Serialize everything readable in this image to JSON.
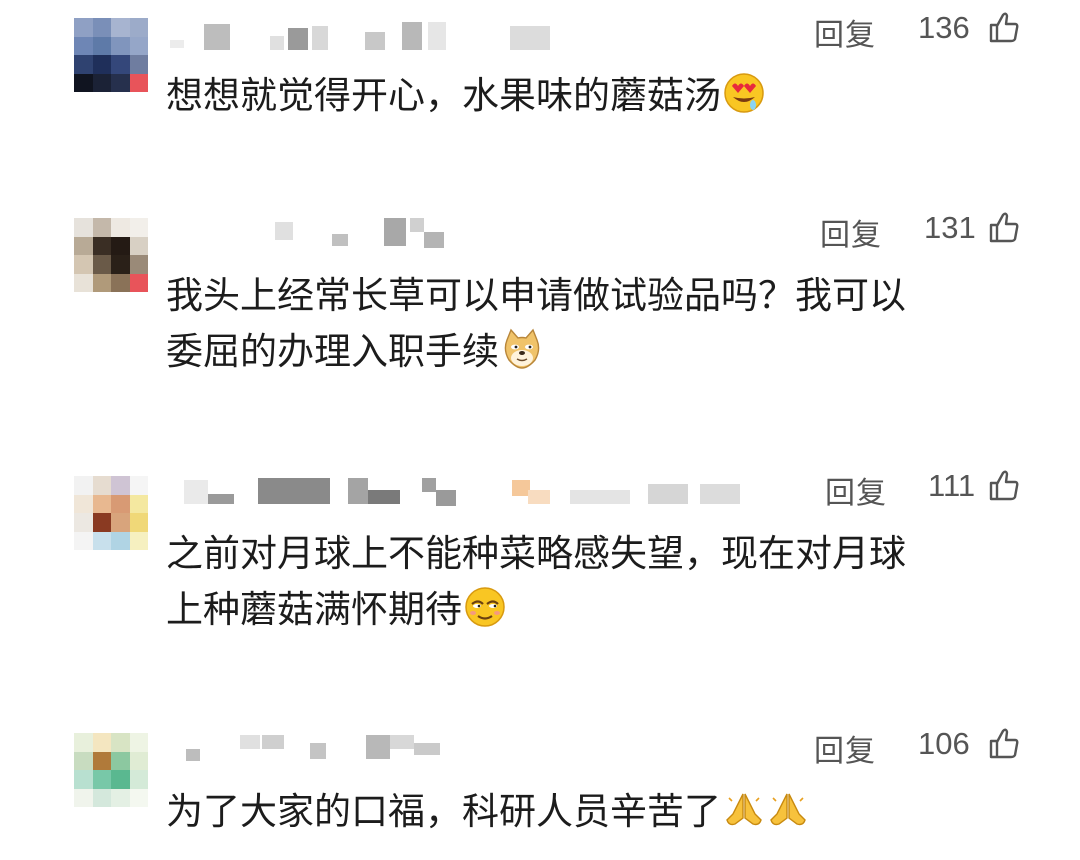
{
  "comments": [
    {
      "reply_label": "回复",
      "likes": "136",
      "text": "想想就觉得开心，水果味的蘑菇汤",
      "emoji": [
        "drooling-heart-eyes-emoji"
      ]
    },
    {
      "reply_label": "回复",
      "likes": "131",
      "text_line1": "我头上经常长草可以申请做试验品吗？我可以",
      "text_line2": "委屈的办理入职手续",
      "emoji": [
        "doge-emoji"
      ]
    },
    {
      "reply_label": "回复",
      "likes": "111",
      "text_line1": "之前对月球上不能种菜略感失望，现在对月球",
      "text_line2": "上种蘑菇满怀期待",
      "emoji": [
        "smug-face-emoji"
      ]
    },
    {
      "reply_label": "回复",
      "likes": "106",
      "text": "为了大家的口福，科研人员辛苦了",
      "emoji": [
        "praying-hands-emoji",
        "praying-hands-emoji"
      ]
    }
  ],
  "colors": {
    "text": "#1c1c1c",
    "meta": "#555555",
    "blur_gray": "#cfcfcf"
  },
  "icons": [
    "thumbs-up-icon"
  ]
}
